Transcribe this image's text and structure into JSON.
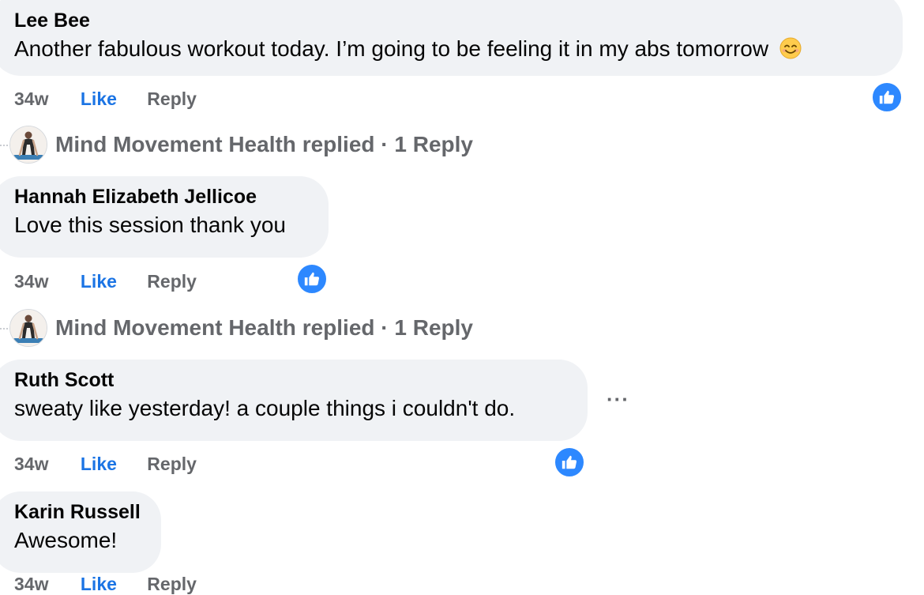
{
  "comments": [
    {
      "author": "Lee Bee",
      "text": "Another fabulous workout today. I’m going to be feeling it in my abs tomorrow",
      "emoji_icon": "smiling-face-emoji",
      "time": "34w",
      "like_label": "Like",
      "reply_label": "Reply",
      "reaction": "like"
    },
    {
      "author": "Hannah Elizabeth Jellicoe",
      "text": "Love this session thank you",
      "time": "34w",
      "like_label": "Like",
      "reply_label": "Reply",
      "reaction": "like"
    },
    {
      "author": "Ruth Scott",
      "text": "sweaty like yesterday! a couple things i couldn't do.",
      "time": "34w",
      "like_label": "Like",
      "reply_label": "Reply",
      "reaction": "like",
      "more_label": "···"
    },
    {
      "author": "Karin Russell",
      "text": "Awesome!",
      "time": "34w",
      "like_label": "Like",
      "reply_label": "Reply"
    }
  ],
  "replies": [
    {
      "text": "Mind Movement Health replied · 1 Reply"
    },
    {
      "text": "Mind Movement Health replied · 1 Reply"
    }
  ],
  "colors": {
    "bubble": "#f0f2f5",
    "like_blue": "#1b74e4",
    "badge_blue": "#2d88ff",
    "muted": "#65676b"
  }
}
